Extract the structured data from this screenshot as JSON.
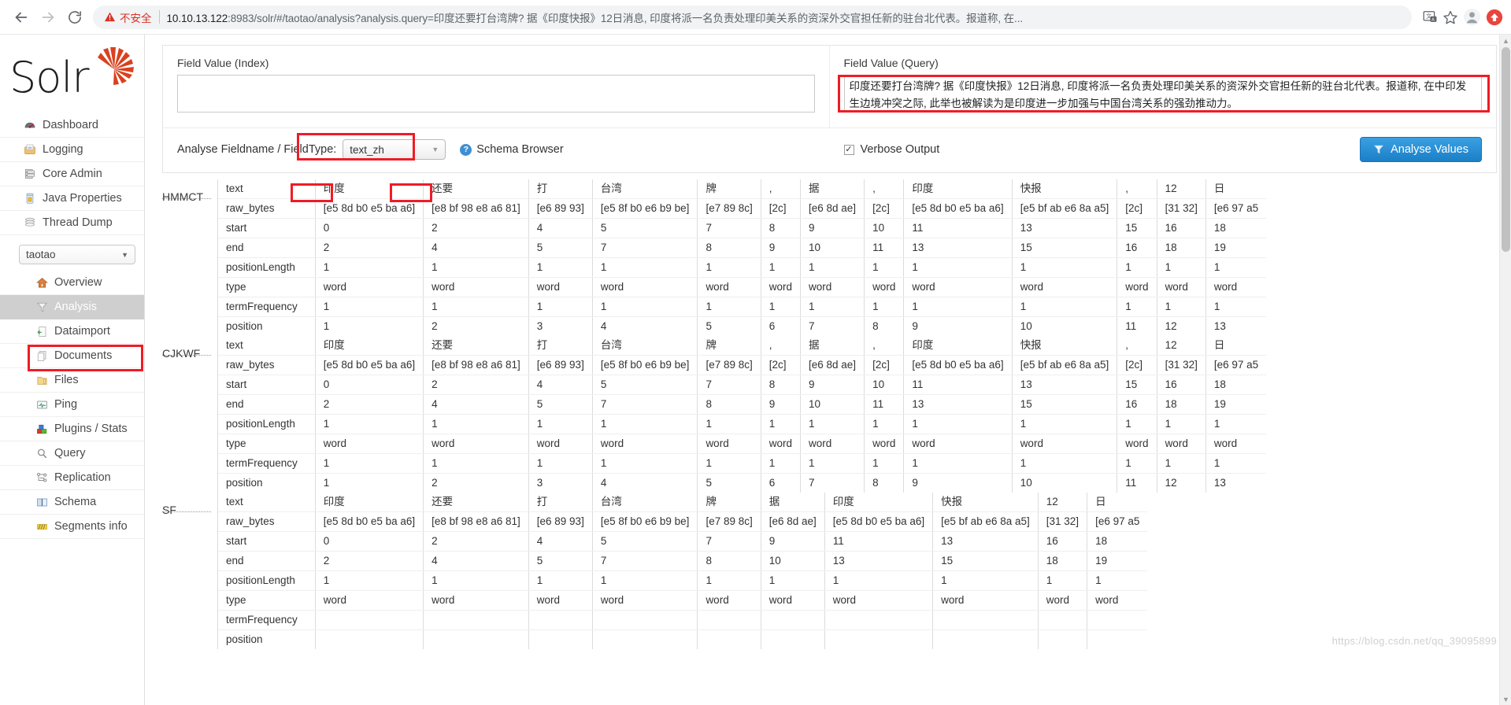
{
  "browser": {
    "back_icon": "arrow-left-icon",
    "forward_icon": "arrow-right-icon",
    "reload_icon": "reload-icon",
    "warning_icon": "warning-triangle-icon",
    "insecure_label": "不安全",
    "url_host": "10.10.13.122",
    "url_rest": ":8983/solr/#/taotao/analysis?analysis.query=印度还要打台湾牌? 据《印度快报》12日消息, 印度将派一名负责处理印美关系的资深外交官担任新的驻台北代表。报道称, 在...",
    "translate_icon": "translate-icon",
    "bookmark_icon": "star-icon",
    "profile_icon": "account-avatar-icon",
    "extension_icon": "update-badge-icon"
  },
  "sidebar": {
    "logo_text": "Solr",
    "logo_icon": "solr-sunburst-icon",
    "global_items": [
      {
        "label": "Dashboard",
        "icon": "dashboard-gauge-icon"
      },
      {
        "label": "Logging",
        "icon": "logging-tray-icon"
      },
      {
        "label": "Core Admin",
        "icon": "core-admin-server-icon"
      },
      {
        "label": "Java Properties",
        "icon": "java-coffee-icon"
      },
      {
        "label": "Thread Dump",
        "icon": "thread-dump-stack-icon"
      }
    ],
    "core_selector": {
      "value": "taotao",
      "caret": "chevron-down-icon"
    },
    "core_items": [
      {
        "label": "Overview",
        "icon": "home-icon",
        "active": false
      },
      {
        "label": "Analysis",
        "icon": "funnel-icon",
        "active": true
      },
      {
        "label": "Dataimport",
        "icon": "dataimport-icon",
        "active": false
      },
      {
        "label": "Documents",
        "icon": "documents-icon",
        "active": false
      },
      {
        "label": "Files",
        "icon": "folder-icon",
        "active": false
      },
      {
        "label": "Ping",
        "icon": "ping-monitor-icon",
        "active": false
      },
      {
        "label": "Plugins / Stats",
        "icon": "plugins-blocks-icon",
        "active": false
      },
      {
        "label": "Query",
        "icon": "magnifier-icon",
        "active": false
      },
      {
        "label": "Replication",
        "icon": "replication-icon",
        "active": false
      },
      {
        "label": "Schema",
        "icon": "book-icon",
        "active": false
      },
      {
        "label": "Segments info",
        "icon": "segments-icon",
        "active": false
      }
    ]
  },
  "form": {
    "index_label": "Field Value (Index)",
    "index_value": "",
    "query_label": "Field Value (Query)",
    "query_value": "印度还要打台湾牌? 据《印度快报》12日消息, 印度将派一名负责处理印美关系的资深外交官担任新的驻台北代表。报道称, 在中印发生边境冲突之际, 此举也被解读为是印度进一步加强与中国台湾关系的强劲推动力。",
    "analyse_fieldname_label": "Analyse Fieldname / FieldType:",
    "fieldtype_value": "text_zh",
    "fieldtype_caret": "chevron-down-icon",
    "help_icon": "question-mark-icon",
    "schema_browser_label": "Schema Browser",
    "verbose_label": "Verbose Output",
    "verbose_checked": true,
    "verbose_check_glyph": "✓",
    "analyse_button_label": "Analyse Values",
    "analyse_button_icon": "funnel-icon",
    "accent_color": "#2b8fd4",
    "highlight_color": "#ee1c25"
  },
  "analysis": {
    "row_labels": [
      "text",
      "raw_bytes",
      "start",
      "end",
      "positionLength",
      "type",
      "termFrequency",
      "position"
    ],
    "blocks": [
      {
        "name": "HMMCT",
        "columns": [
          {
            "text": "印度",
            "raw_bytes": "[e5 8d b0 e5 ba a6]",
            "start": "0",
            "end": "2",
            "positionLength": "1",
            "type": "word",
            "termFrequency": "1",
            "position": "1"
          },
          {
            "text": "还要",
            "raw_bytes": "[e8 bf 98 e8 a6 81]",
            "start": "2",
            "end": "4",
            "positionLength": "1",
            "type": "word",
            "termFrequency": "1",
            "position": "2"
          },
          {
            "text": "打",
            "raw_bytes": "[e6 89 93]",
            "start": "4",
            "end": "5",
            "positionLength": "1",
            "type": "word",
            "termFrequency": "1",
            "position": "3"
          },
          {
            "text": "台湾",
            "raw_bytes": "[e5 8f b0 e6 b9 be]",
            "start": "5",
            "end": "7",
            "positionLength": "1",
            "type": "word",
            "termFrequency": "1",
            "position": "4"
          },
          {
            "text": "牌",
            "raw_bytes": "[e7 89 8c]",
            "start": "7",
            "end": "8",
            "positionLength": "1",
            "type": "word",
            "termFrequency": "1",
            "position": "5"
          },
          {
            "text": ",",
            "raw_bytes": "[2c]",
            "start": "8",
            "end": "9",
            "positionLength": "1",
            "type": "word",
            "termFrequency": "1",
            "position": "6"
          },
          {
            "text": "据",
            "raw_bytes": "[e6 8d ae]",
            "start": "9",
            "end": "10",
            "positionLength": "1",
            "type": "word",
            "termFrequency": "1",
            "position": "7"
          },
          {
            "text": ",",
            "raw_bytes": "[2c]",
            "start": "10",
            "end": "11",
            "positionLength": "1",
            "type": "word",
            "termFrequency": "1",
            "position": "8"
          },
          {
            "text": "印度",
            "raw_bytes": "[e5 8d b0 e5 ba a6]",
            "start": "11",
            "end": "13",
            "positionLength": "1",
            "type": "word",
            "termFrequency": "1",
            "position": "9"
          },
          {
            "text": "快报",
            "raw_bytes": "[e5 bf ab e6 8a a5]",
            "start": "13",
            "end": "15",
            "positionLength": "1",
            "type": "word",
            "termFrequency": "1",
            "position": "10"
          },
          {
            "text": ",",
            "raw_bytes": "[2c]",
            "start": "15",
            "end": "16",
            "positionLength": "1",
            "type": "word",
            "termFrequency": "1",
            "position": "11"
          },
          {
            "text": "12",
            "raw_bytes": "[31 32]",
            "start": "16",
            "end": "18",
            "positionLength": "1",
            "type": "word",
            "termFrequency": "1",
            "position": "12"
          },
          {
            "text": "日",
            "raw_bytes": "[e6 97 a5",
            "start": "18",
            "end": "19",
            "positionLength": "1",
            "type": "word",
            "termFrequency": "1",
            "position": "13"
          }
        ]
      },
      {
        "name": "CJKWF",
        "columns": [
          {
            "text": "印度",
            "raw_bytes": "[e5 8d b0 e5 ba a6]",
            "start": "0",
            "end": "2",
            "positionLength": "1",
            "type": "word",
            "termFrequency": "1",
            "position": "1"
          },
          {
            "text": "还要",
            "raw_bytes": "[e8 bf 98 e8 a6 81]",
            "start": "2",
            "end": "4",
            "positionLength": "1",
            "type": "word",
            "termFrequency": "1",
            "position": "2"
          },
          {
            "text": "打",
            "raw_bytes": "[e6 89 93]",
            "start": "4",
            "end": "5",
            "positionLength": "1",
            "type": "word",
            "termFrequency": "1",
            "position": "3"
          },
          {
            "text": "台湾",
            "raw_bytes": "[e5 8f b0 e6 b9 be]",
            "start": "5",
            "end": "7",
            "positionLength": "1",
            "type": "word",
            "termFrequency": "1",
            "position": "4"
          },
          {
            "text": "牌",
            "raw_bytes": "[e7 89 8c]",
            "start": "7",
            "end": "8",
            "positionLength": "1",
            "type": "word",
            "termFrequency": "1",
            "position": "5"
          },
          {
            "text": ",",
            "raw_bytes": "[2c]",
            "start": "8",
            "end": "9",
            "positionLength": "1",
            "type": "word",
            "termFrequency": "1",
            "position": "6"
          },
          {
            "text": "据",
            "raw_bytes": "[e6 8d ae]",
            "start": "9",
            "end": "10",
            "positionLength": "1",
            "type": "word",
            "termFrequency": "1",
            "position": "7"
          },
          {
            "text": ",",
            "raw_bytes": "[2c]",
            "start": "10",
            "end": "11",
            "positionLength": "1",
            "type": "word",
            "termFrequency": "1",
            "position": "8"
          },
          {
            "text": "印度",
            "raw_bytes": "[e5 8d b0 e5 ba a6]",
            "start": "11",
            "end": "13",
            "positionLength": "1",
            "type": "word",
            "termFrequency": "1",
            "position": "9"
          },
          {
            "text": "快报",
            "raw_bytes": "[e5 bf ab e6 8a a5]",
            "start": "13",
            "end": "15",
            "positionLength": "1",
            "type": "word",
            "termFrequency": "1",
            "position": "10"
          },
          {
            "text": ",",
            "raw_bytes": "[2c]",
            "start": "15",
            "end": "16",
            "positionLength": "1",
            "type": "word",
            "termFrequency": "1",
            "position": "11"
          },
          {
            "text": "12",
            "raw_bytes": "[31 32]",
            "start": "16",
            "end": "18",
            "positionLength": "1",
            "type": "word",
            "termFrequency": "1",
            "position": "12"
          },
          {
            "text": "日",
            "raw_bytes": "[e6 97 a5",
            "start": "18",
            "end": "19",
            "positionLength": "1",
            "type": "word",
            "termFrequency": "1",
            "position": "13"
          }
        ]
      },
      {
        "name": "SF",
        "columns": [
          {
            "text": "印度",
            "raw_bytes": "[e5 8d b0 e5 ba a6]",
            "start": "0",
            "end": "2",
            "positionLength": "1",
            "type": "word",
            "termFrequency": "",
            "position": ""
          },
          {
            "text": "还要",
            "raw_bytes": "[e8 bf 98 e8 a6 81]",
            "start": "2",
            "end": "4",
            "positionLength": "1",
            "type": "word",
            "termFrequency": "",
            "position": ""
          },
          {
            "text": "打",
            "raw_bytes": "[e6 89 93]",
            "start": "4",
            "end": "5",
            "positionLength": "1",
            "type": "word",
            "termFrequency": "",
            "position": ""
          },
          {
            "text": "台湾",
            "raw_bytes": "[e5 8f b0 e6 b9 be]",
            "start": "5",
            "end": "7",
            "positionLength": "1",
            "type": "word",
            "termFrequency": "",
            "position": ""
          },
          {
            "text": "牌",
            "raw_bytes": "[e7 89 8c]",
            "start": "7",
            "end": "8",
            "positionLength": "1",
            "type": "word",
            "termFrequency": "",
            "position": ""
          },
          {
            "text": "据",
            "raw_bytes": "[e6 8d ae]",
            "start": "9",
            "end": "10",
            "positionLength": "1",
            "type": "word",
            "termFrequency": "",
            "position": ""
          },
          {
            "text": "印度",
            "raw_bytes": "[e5 8d b0 e5 ba a6]",
            "start": "11",
            "end": "13",
            "positionLength": "1",
            "type": "word",
            "termFrequency": "",
            "position": ""
          },
          {
            "text": "快报",
            "raw_bytes": "[e5 bf ab e6 8a a5]",
            "start": "13",
            "end": "15",
            "positionLength": "1",
            "type": "word",
            "termFrequency": "",
            "position": ""
          },
          {
            "text": "12",
            "raw_bytes": "[31 32]",
            "start": "16",
            "end": "18",
            "positionLength": "1",
            "type": "word",
            "termFrequency": "",
            "position": ""
          },
          {
            "text": "日",
            "raw_bytes": "[e6 97 a5",
            "start": "18",
            "end": "19",
            "positionLength": "1",
            "type": "word",
            "termFrequency": "",
            "position": ""
          }
        ]
      }
    ]
  },
  "watermark": "https://blog.csdn.net/qq_39095899"
}
